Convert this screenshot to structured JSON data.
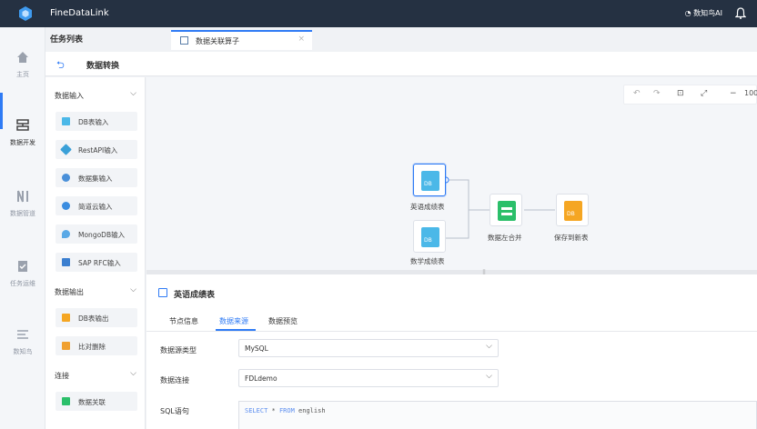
{
  "app": {
    "title": "FineDataLink",
    "ai_label": "数知鸟AI"
  },
  "leftnav": {
    "items": [
      {
        "label": "主页",
        "icon": "home-icon"
      },
      {
        "label": "数据开发",
        "icon": "data-dev-icon"
      },
      {
        "label": "数据管道",
        "icon": "pipeline-icon"
      },
      {
        "label": "任务运维",
        "icon": "ops-icon"
      },
      {
        "label": "数知鸟",
        "icon": "list-icon"
      }
    ]
  },
  "tasklist_title": "任务列表",
  "tab": {
    "label": "数据关联算子",
    "close": "×"
  },
  "subheader": {
    "back": "⮌",
    "title": "数据转换"
  },
  "palette": {
    "groups": [
      {
        "label": "数据输入",
        "items": [
          "DB表输入",
          "RestAPI输入",
          "数据集输入",
          "简道云输入",
          "MongoDB输入",
          "SAP RFC输入"
        ]
      },
      {
        "label": "数据输出",
        "items": [
          "DB表输出",
          "比对删除"
        ]
      },
      {
        "label": "连接",
        "items": [
          "数据关联"
        ]
      }
    ]
  },
  "toolbar": {
    "undo": "↶",
    "redo": "↷",
    "fit": "⊡",
    "layout": "⤢",
    "minus": "−",
    "zoom": "100"
  },
  "nodes": {
    "english": {
      "label": "英语成绩表",
      "badge": "DB"
    },
    "math": {
      "label": "数学成绩表",
      "badge": "DB"
    },
    "join": {
      "label": "数据左合并"
    },
    "save": {
      "label": "保存到新表",
      "badge": "DB"
    }
  },
  "panel": {
    "title": "英语成绩表",
    "tabs": [
      "节点信息",
      "数据来源",
      "数据预览"
    ],
    "active_tab": "数据来源",
    "fields": {
      "source_type_label": "数据源类型",
      "source_type_value": "MySQL",
      "connection_label": "数据连接",
      "connection_value": "FDLdemo",
      "sql_label": "SQL语句",
      "sql_select": "SELECT",
      "sql_star": " * ",
      "sql_from": "FROM",
      "sql_table": " english"
    }
  },
  "colors": {
    "accent": "#2f7bf5",
    "topbar": "#253142",
    "db_node": "#4bb8e8",
    "join_node": "#2bbf6a",
    "save_node": "#f5a623"
  }
}
